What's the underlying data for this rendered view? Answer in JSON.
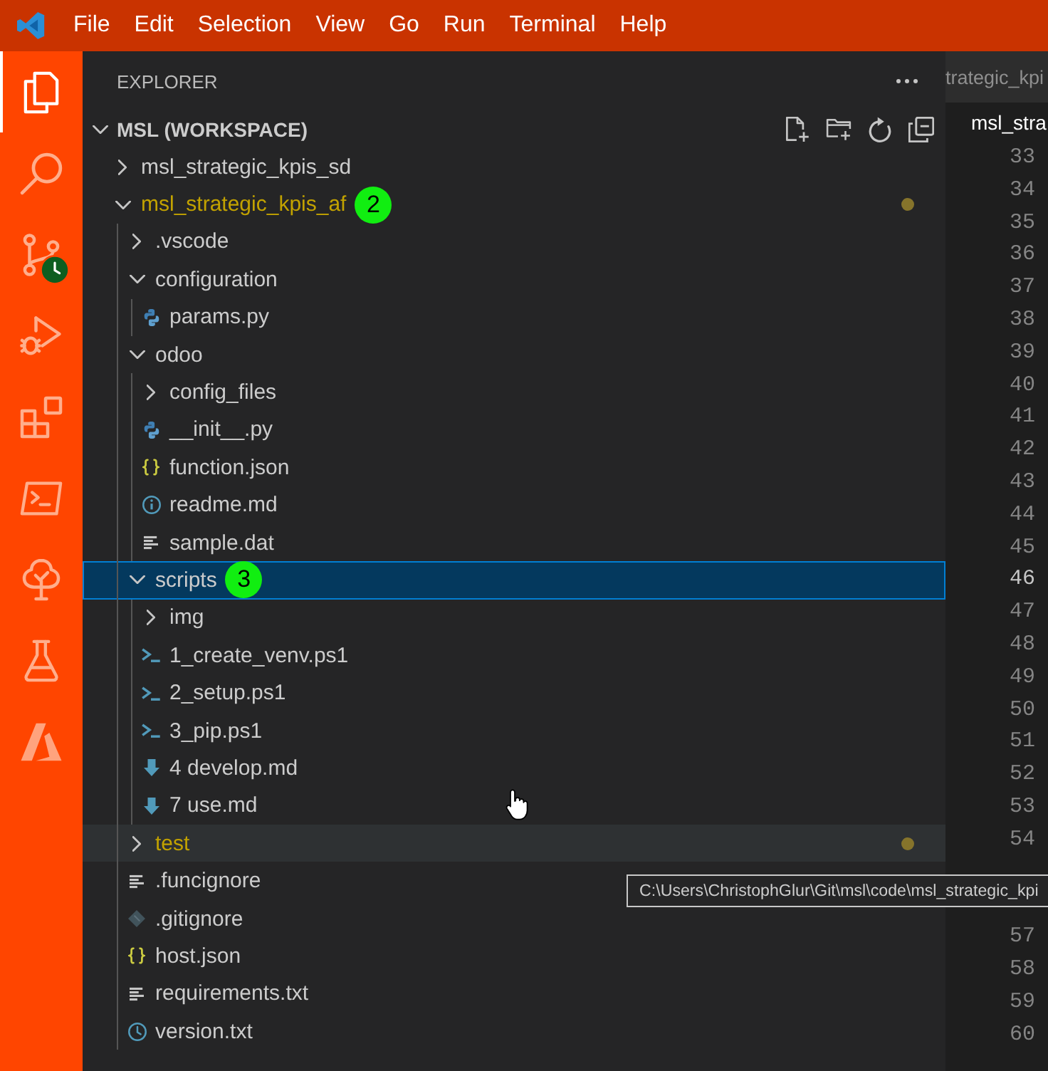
{
  "menu_bar": {
    "items": [
      "File",
      "Edit",
      "Selection",
      "View",
      "Go",
      "Run",
      "Terminal",
      "Help"
    ]
  },
  "activity_bar": [
    {
      "kind": "files",
      "selected": true
    },
    {
      "kind": "search",
      "selected": false
    },
    {
      "kind": "branch",
      "selected": false,
      "clock_badge": true
    },
    {
      "kind": "debug",
      "selected": false
    },
    {
      "kind": "extensions",
      "selected": false
    },
    {
      "kind": "terminal",
      "selected": false
    },
    {
      "kind": "tree",
      "selected": false
    },
    {
      "kind": "flask",
      "selected": false
    },
    {
      "kind": "azure",
      "selected": false
    }
  ],
  "explorer": {
    "title": "EXPLORER",
    "workspace": {
      "label": "MSL (WORKSPACE)",
      "expanded": true
    },
    "tree": [
      {
        "label": "msl_strategic_kpis_sd",
        "kind": "folder",
        "expanded": false,
        "selected": false,
        "hovered": false,
        "modified": false
      },
      {
        "label": "msl_strategic_kpis_af",
        "kind": "folder",
        "expanded": true,
        "selected": false,
        "hovered": false,
        "modified": true,
        "badge": "2",
        "children": [
          {
            "label": ".vscode",
            "kind": "folder",
            "expanded": false,
            "selected": false,
            "hovered": false,
            "modified": false
          },
          {
            "label": "configuration",
            "kind": "folder",
            "expanded": true,
            "selected": false,
            "hovered": false,
            "modified": false,
            "children": [
              {
                "label": "params.py",
                "kind": "python",
                "selected": false,
                "hovered": false,
                "modified": false
              }
            ]
          },
          {
            "label": "odoo",
            "kind": "folder",
            "expanded": true,
            "selected": false,
            "hovered": false,
            "modified": false,
            "children": [
              {
                "label": "config_files",
                "kind": "folder",
                "expanded": false,
                "selected": false,
                "hovered": false,
                "modified": false
              },
              {
                "label": "__init__.py",
                "kind": "python",
                "selected": false,
                "hovered": false,
                "modified": false
              },
              {
                "label": "function.json",
                "kind": "json",
                "selected": false,
                "hovered": false,
                "modified": false
              },
              {
                "label": "readme.md",
                "kind": "readme",
                "selected": false,
                "hovered": false,
                "modified": false
              },
              {
                "label": "sample.dat",
                "kind": "text",
                "selected": false,
                "hovered": false,
                "modified": false
              }
            ]
          },
          {
            "label": "scripts",
            "kind": "folder",
            "expanded": true,
            "selected": true,
            "hovered": false,
            "modified": false,
            "badge": "3",
            "children": [
              {
                "label": "img",
                "kind": "folder",
                "expanded": false,
                "selected": false,
                "hovered": false,
                "modified": false
              },
              {
                "label": "1_create_venv.ps1",
                "kind": "powershell",
                "selected": false,
                "hovered": false,
                "modified": false
              },
              {
                "label": "2_setup.ps1",
                "kind": "powershell",
                "selected": false,
                "hovered": false,
                "modified": false
              },
              {
                "label": "3_pip.ps1",
                "kind": "powershell",
                "selected": false,
                "hovered": false,
                "modified": false
              },
              {
                "label": "4 develop.md",
                "kind": "markdown",
                "selected": false,
                "hovered": false,
                "modified": false
              },
              {
                "label": "7 use.md",
                "kind": "markdown",
                "selected": false,
                "hovered": false,
                "modified": false
              }
            ]
          },
          {
            "label": "test",
            "kind": "folder",
            "expanded": false,
            "selected": false,
            "hovered": true,
            "modified": true
          },
          {
            "label": ".funcignore",
            "kind": "text",
            "selected": false,
            "hovered": false,
            "modified": false
          },
          {
            "label": ".gitignore",
            "kind": "git",
            "selected": false,
            "hovered": false,
            "modified": false
          },
          {
            "label": "host.json",
            "kind": "json",
            "selected": false,
            "hovered": false,
            "modified": false
          },
          {
            "label": "requirements.txt",
            "kind": "text",
            "selected": false,
            "hovered": false,
            "modified": false
          },
          {
            "label": "version.txt",
            "kind": "version",
            "selected": false,
            "hovered": false,
            "modified": false
          }
        ]
      }
    ]
  },
  "editor": {
    "tabs": [
      {
        "label": "trategic_kpi",
        "selected": false
      },
      {
        "label": "msl_stra",
        "selected": true
      }
    ],
    "line_numbers": [
      {
        "number": "33",
        "current": false
      },
      {
        "number": "34",
        "current": false
      },
      {
        "number": "35",
        "current": false
      },
      {
        "number": "36",
        "current": false
      },
      {
        "number": "37",
        "current": false
      },
      {
        "number": "38",
        "current": false
      },
      {
        "number": "39",
        "current": false
      },
      {
        "number": "40",
        "current": false
      },
      {
        "number": "41",
        "current": false
      },
      {
        "number": "42",
        "current": false
      },
      {
        "number": "43",
        "current": false
      },
      {
        "number": "44",
        "current": false
      },
      {
        "number": "45",
        "current": false
      },
      {
        "number": "46",
        "current": true
      },
      {
        "number": "47",
        "current": false
      },
      {
        "number": "48",
        "current": false
      },
      {
        "number": "49",
        "current": false
      },
      {
        "number": "50",
        "current": false
      },
      {
        "number": "51",
        "current": false
      },
      {
        "number": "52",
        "current": false
      },
      {
        "number": "53",
        "current": false
      },
      {
        "number": "54",
        "current": false
      }
    ],
    "line_numbers_below_tooltip": [
      {
        "number": "57",
        "current": false
      },
      {
        "number": "58",
        "current": false
      },
      {
        "number": "59",
        "current": false
      },
      {
        "number": "60",
        "current": false
      }
    ]
  },
  "tooltip": {
    "text": "C:\\Users\\ChristophGlur\\Git\\msl\\code\\msl_strategic_kpi"
  }
}
